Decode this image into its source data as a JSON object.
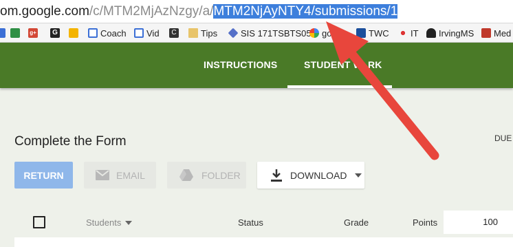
{
  "browser": {
    "url_parts": {
      "host": "om.google.com",
      "path": "/c/MTM2MjAzNzgy/a/",
      "selected": "MTM2NjAyNTY4/submissions/1"
    }
  },
  "bookmarks": [
    {
      "label": "",
      "icon": "profile-icon"
    },
    {
      "label": "",
      "icon": "google-plus-icon"
    },
    {
      "label": "",
      "icon": "g-icon"
    },
    {
      "label": "",
      "icon": "lightbulb-icon"
    },
    {
      "label": "Coach",
      "icon": "window-icon"
    },
    {
      "label": "Vid",
      "icon": "window-icon"
    },
    {
      "label": "",
      "icon": "c-icon"
    },
    {
      "label": "Tips",
      "icon": "folder-icon"
    },
    {
      "label": "SIS 171TSBTS05/",
      "icon": "diamond-icon"
    },
    {
      "label": "go...l",
      "icon": "google-icon"
    },
    {
      "label": "TWC",
      "icon": "weather-icon"
    },
    {
      "label": "IT",
      "icon": "dots-icon"
    },
    {
      "label": "IrvingMS",
      "icon": "mascot-icon"
    },
    {
      "label": "Med",
      "icon": "book-icon"
    }
  ],
  "nav": {
    "tabs": [
      {
        "label": "INSTRUCTIONS"
      },
      {
        "label": "STUDENT W_RK"
      }
    ]
  },
  "assignment": {
    "title": "Complete the Form",
    "due": "DUE"
  },
  "actions": {
    "return_label": "RETURN",
    "email_label": "EMAIL",
    "folder_label": "FOLDER",
    "download_label": "DOWNLOAD"
  },
  "table": {
    "headers": {
      "students": "Students",
      "status": "Status",
      "grade": "Grade",
      "points": "Points"
    },
    "points_value": "100"
  },
  "colors": {
    "accent_green": "#4a7a27",
    "return_blue": "#8fb7ea",
    "arrow_red": "#e8463c",
    "selection_blue": "#3d7fdc"
  }
}
